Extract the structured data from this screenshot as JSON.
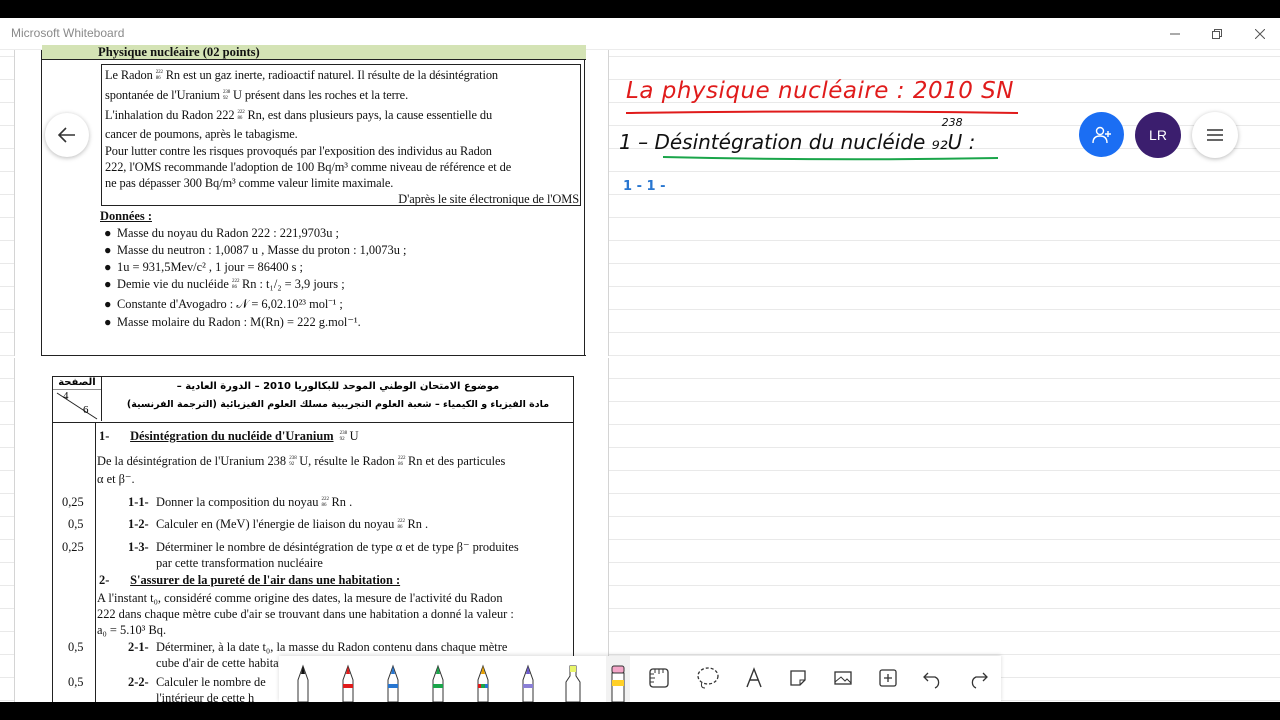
{
  "window": {
    "title": "Microsoft Whiteboard"
  },
  "doc1": {
    "header": "Physique nucléaire (02 points)",
    "p1a": "Le Radon",
    "p1a_sym": "Rn",
    "p1a_m": "222",
    "p1a_z": "86",
    "p1b": "est un gaz inerte, radioactif naturel. Il résulte de la désintégration",
    "p2a": "spontanée de l'Uranium",
    "p2_sym": "U",
    "p2_m": "238",
    "p2_z": "92",
    "p2b": "présent dans les roches et la terre.",
    "p3a": "L'inhalation du Radon 222",
    "p3_sym": "Rn",
    "p3_m": "222",
    "p3_z": "86",
    "p3b": ", est dans plusieurs pays, la cause essentielle du",
    "p4": "cancer de poumons, après le tabagisme.",
    "p5": "Pour lutter contre les risques provoqués par l'exposition des individus au Radon",
    "p6": "222, l'OMS recommande l'adoption de 100 Bq/m³ comme niveau de référence et de",
    "p7": "ne pas dépasser 300 Bq/m³ comme valeur limite maximale.",
    "source": "D'après le site électronique de l'OMS",
    "donnees": "Données :",
    "d1": "Masse du noyau du Radon 222  :   221,9703u ;",
    "d2": "Masse du neutron : 1,0087 u   ,   Masse du proton : 1,0073u ;",
    "d3": "1u = 931,5Mev/c²   ,   1 jour = 86400 s ;",
    "d4a": "Demie vie du nucléide",
    "d4_sym": "Rn",
    "d4_m": "222",
    "d4_z": "86",
    "d4b": ":  t₁/₂ = 3,9 jours ;",
    "d5": "Constante d'Avogadro : 𝒩 = 6,02.10²³ mol⁻¹ ;",
    "d6": "Masse molaire du Radon : M(Rn) = 222 g.mol⁻¹."
  },
  "doc2": {
    "page_label": "الصفحة",
    "page_num": "4",
    "page_total": "6",
    "ar1": "موضوع الامتحان الوطني الموحد للبكالوريا  2010  – الدورة العادية –",
    "ar2": "مادة الفيزياء و الكيمياء – شعبة العلوم التجريبية مسلك العلوم الفيزيائية (الترجمة الفرنسية)",
    "s1_num": "1-",
    "s1_title": "Désintégration du nucléide d'Uranium",
    "s1_sym": "U",
    "s1_m": "238",
    "s1_z": "92",
    "s1_l1a": "De la désintégration de l'Uranium 238",
    "s1_l1_sym": "U",
    "s1_l1b": ", résulte le Radon",
    "s1_l1c": "Rn et des particules",
    "s1_l2": "α et β⁻.",
    "q11_pts": "0,25",
    "q11_num": "1-1-",
    "q11_text": "Donner la composition du noyau",
    "q11_end": "Rn .",
    "q12_pts": "0,5",
    "q12_num": "1-2-",
    "q12_text": "Calculer en (MeV) l'énergie de liaison du noyau",
    "q12_end": "Rn .",
    "q13_pts": "0,25",
    "q13_num": "1-3-",
    "q13_text": "Déterminer le nombre de désintégration de type α et de type β⁻ produites",
    "q13_text2": "par cette transformation nucléaire",
    "s2_num": "2-",
    "s2_title": "S'assurer de la pureté de l'air dans une habitation :",
    "s2_l1": "A l'instant t₀, considéré comme origine des dates, la mesure de l'activité du Radon",
    "s2_l2": "222 dans chaque mètre cube d'air se trouvant dans une habitation a donné la valeur :",
    "s2_l3": "a₀ = 5.10³ Bq.",
    "q21_pts": "0,5",
    "q21_num": "2-1-",
    "q21_text": "Déterminer, à la date t₀, la masse du Radon contenu dans chaque mètre",
    "q21_text2": "cube d'air de cette habitation",
    "q22_pts": "0,5",
    "q22_num": "2-2-",
    "q22_text": "Calculer le nombre de",
    "q22_text2": "l'intérieur de cette h"
  },
  "handwriting": {
    "title": "La physique nucléaire : 2010   SN",
    "line1": "1 –  Désintégration  du nucléide",
    "line1_sym": "₉₂U :",
    "line1_sup": "238",
    "line2": "1 - 1 -"
  },
  "controls": {
    "back_icon": "arrow-left-icon",
    "invite_icon": "add-person-icon",
    "avatar_initials": "LR",
    "menu_icon": "hamburger-icon"
  },
  "colors": {
    "red_ink": "#e01b1b",
    "green_ink": "#1aa54a",
    "blue_ink": "#2876d0",
    "purple_avatar": "#3b1e6e",
    "blue_button": "#1b6ef3"
  }
}
